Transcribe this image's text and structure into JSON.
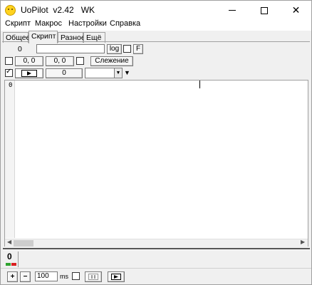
{
  "window": {
    "title": "UoPilot  v2.42   WK",
    "icons": {
      "app": "smiley-icon",
      "minimize": "minimize-icon",
      "maximize": "maximize-icon",
      "close": "close-icon"
    }
  },
  "menu": [
    "Скрипт",
    "Макрос",
    "Настройки",
    "Справка"
  ],
  "tabs": [
    {
      "label": "Общее",
      "active": false
    },
    {
      "label": "Скрипт",
      "active": true
    },
    {
      "label": "Разное",
      "active": false
    },
    {
      "label": "Ещё",
      "active": false
    }
  ],
  "controls": {
    "row1": {
      "counter": "0",
      "path_value": "",
      "log_label": "log",
      "f_checked": false,
      "f_label": "F"
    },
    "row2": {
      "coord1": "0, 0",
      "coord2": "0, 0",
      "chk_left": false,
      "chk_mid": false,
      "tracking_label": "Слежение"
    },
    "row3": {
      "enabled_checked": true,
      "value": "0",
      "combo_value": ""
    }
  },
  "editor": {
    "line_number": "0",
    "content": ""
  },
  "status": {
    "counter": "0",
    "indicator_colors": [
      "#2fa32f",
      "#d92020"
    ]
  },
  "bottombar": {
    "plus_label": "+",
    "minus_label": "−",
    "delay_value": "100",
    "ms_label": "ms",
    "ms_checked": false,
    "icons": {
      "pause": "pause-icon",
      "play": "play-icon"
    }
  }
}
